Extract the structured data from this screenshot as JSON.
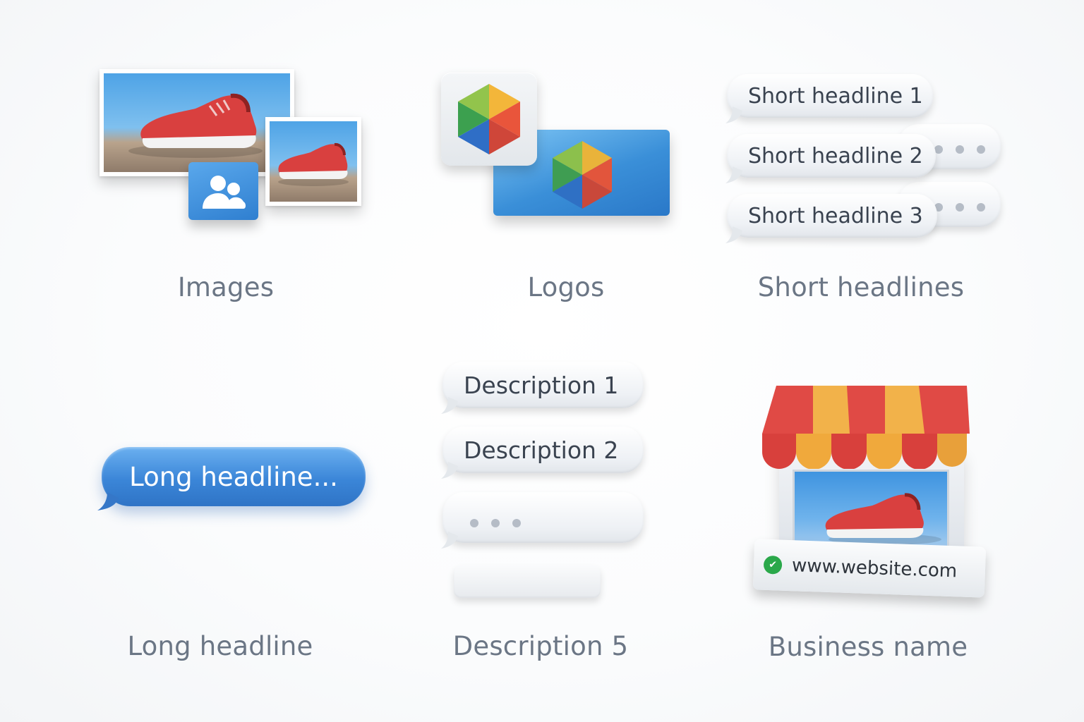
{
  "captions": {
    "images": "Images",
    "logos": "Logos",
    "short_headlines": "Short headlines",
    "long_headline": "Long headline",
    "description5": "Description 5",
    "business_name": "Business name"
  },
  "short_headlines": [
    "Short headline 1",
    "Short headline 2",
    "Short headline 3"
  ],
  "long_headline_text": "Long headline...",
  "descriptions": [
    "Description 1",
    "Description 2"
  ],
  "store_sign_url": "www.website.com",
  "icons": {
    "image_placeholder": "image-placeholder-icon",
    "logo_cube": "hexagon-cube-logo-icon",
    "verified": "checkmark-badge-icon"
  },
  "colors": {
    "caption": "#6b7685",
    "blue_bubble": "#3b86d8",
    "shoe_red": "#d9403f",
    "awning_red": "#e04a45",
    "awning_yellow": "#f2b24a"
  }
}
